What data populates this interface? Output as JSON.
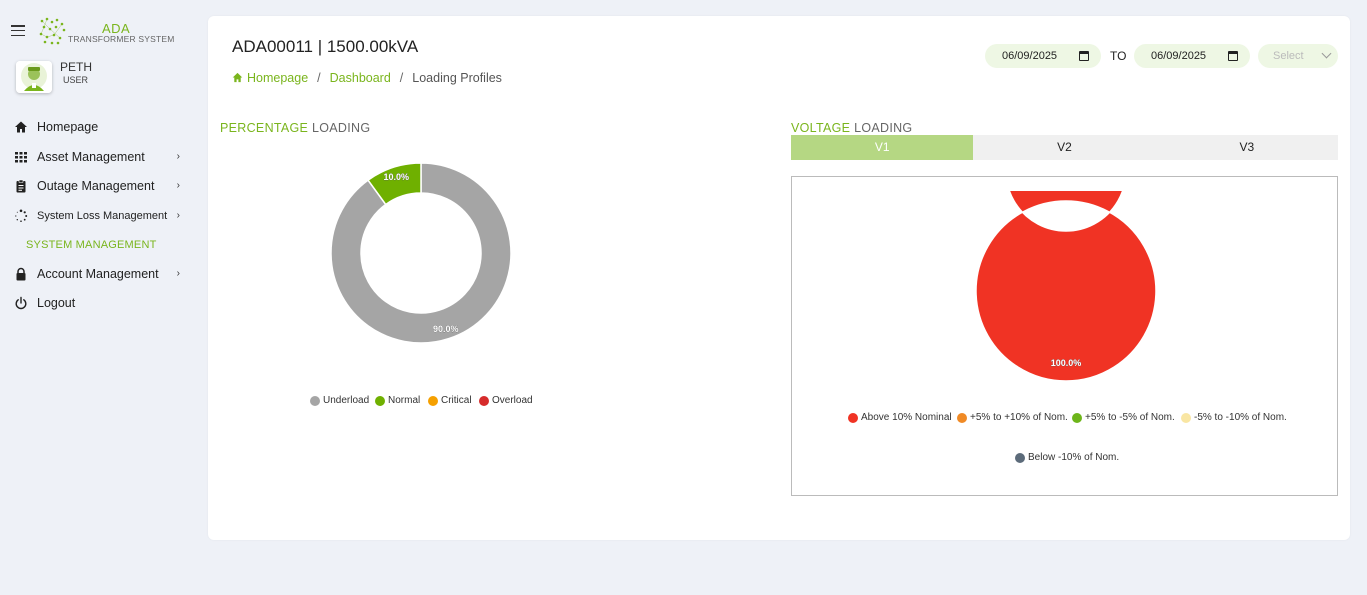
{
  "app": {
    "logo_title": "ADA",
    "logo_subtitle": "TRANSFORMER SYSTEM"
  },
  "user": {
    "name": "PETH",
    "role": "USER"
  },
  "sidebar": {
    "items": [
      {
        "label": "Homepage",
        "icon": "home-icon",
        "has_submenu": false
      },
      {
        "label": "Asset Management",
        "icon": "grid-icon",
        "has_submenu": true
      },
      {
        "label": "Outage Management",
        "icon": "clipboard-icon",
        "has_submenu": true
      },
      {
        "label": "System Loss Management",
        "icon": "spinner-icon",
        "has_submenu": true
      }
    ],
    "section_label": "SYSTEM MANAGEMENT",
    "items_bottom": [
      {
        "label": "Account Management",
        "icon": "lock-icon",
        "has_submenu": true
      },
      {
        "label": "Logout",
        "icon": "power-icon",
        "has_submenu": false
      }
    ]
  },
  "header": {
    "title": "ADA00011 | 1500.00kVA",
    "breadcrumb": {
      "home": "Homepage",
      "dashboard": "Dashboard",
      "current": "Loading Profiles"
    },
    "date_from": "06/09/2025",
    "to_label": "TO",
    "date_to": "06/09/2025",
    "select_placeholder": "Select"
  },
  "percentage": {
    "title_highlight": "PERCENTAGE",
    "title_rest": "LOADING"
  },
  "voltage": {
    "title_highlight": "VOLTAGE",
    "title_rest": "LOADING",
    "tabs": [
      "V1",
      "V2",
      "V3"
    ],
    "active_tab": "V1"
  },
  "colors": {
    "accent": "#7ab51d",
    "underload": "#a5a5a5",
    "normal": "#6fb000",
    "critical": "#f5a000",
    "overload": "#d62b2b",
    "above10": "#f03324",
    "plus5to10": "#f08a25",
    "plus5minus5": "#6db51a",
    "minus5to10": "#f9e6a3",
    "below10": "#5c6b7a"
  },
  "chart_data": [
    {
      "type": "pie",
      "variant": "donut",
      "categories": [
        "Underload",
        "Normal",
        "Critical",
        "Overload"
      ],
      "values": [
        90.0,
        10.0,
        0,
        0
      ],
      "data_labels": [
        "90.0%",
        "10.0%",
        "",
        ""
      ],
      "legend_position": "bottom"
    },
    {
      "type": "pie",
      "variant": "donut",
      "categories": [
        "Above 10% Nominal",
        "+5% to +10% of Nom.",
        "+5% to -5% of Nom.",
        "-5% to -10% of Nom.",
        "Below -10% of Nom."
      ],
      "values": [
        100.0,
        0,
        0,
        0,
        0
      ],
      "data_labels": [
        "100.0%",
        "",
        "",
        "",
        ""
      ],
      "legend_position": "bottom"
    }
  ]
}
